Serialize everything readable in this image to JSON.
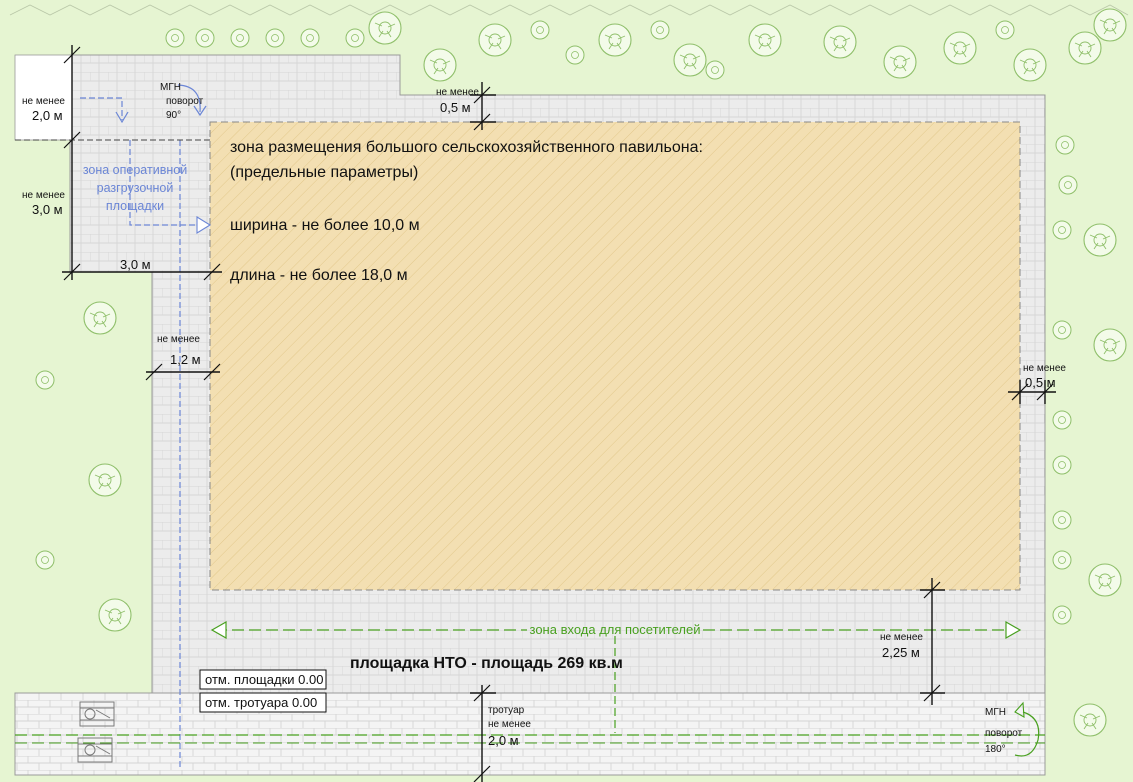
{
  "pavilion": {
    "title": "зона размещения большого сельскохозяйственного павильона:",
    "subtitle": "(предельные параметры)",
    "width_limit": "ширина - не более 10,0 м",
    "length_limit": "длина - не более 18,0 м"
  },
  "site_label": "площадка НТО - площадь 269 кв.м",
  "levels": {
    "site": "отм. площадки 0.00",
    "sidewalk": "отм. тротуара 0.00"
  },
  "unloading_zone": [
    "зона оперативной",
    "разгрузочной",
    "площадки"
  ],
  "entrance_zone": "зона входа для посетителей",
  "mgn_90": [
    "МГН",
    "поворот",
    "90°"
  ],
  "mgn_180": [
    "МГН",
    "поворот",
    "180°"
  ],
  "dimensions": {
    "top_left": {
      "label": "не менее",
      "value": "2,0 м"
    },
    "left": {
      "label": "не менее",
      "value": "3,0 м"
    },
    "bottom_left": {
      "value": "3,0 м"
    },
    "top": {
      "label": "не менее",
      "value": "0,5 м"
    },
    "inner": {
      "label": "не менее",
      "value": "1,2 м"
    },
    "right": {
      "label": "не менее",
      "value": "0,5 м"
    },
    "entrance": {
      "label": "не менее",
      "value": "2,25 м"
    },
    "sidewalk": {
      "label1": "тротуар",
      "label2": "не менее",
      "value": "2,0 м"
    }
  },
  "colors": {
    "grass": "#e6f5d2",
    "paving": "#ececec",
    "pavilion": "#f3dfb2",
    "unloading": "#6b86d6",
    "entrance": "#48a01f"
  },
  "icons": [
    "tree-icon",
    "wheelchair-icon",
    "arrow-icon"
  ]
}
